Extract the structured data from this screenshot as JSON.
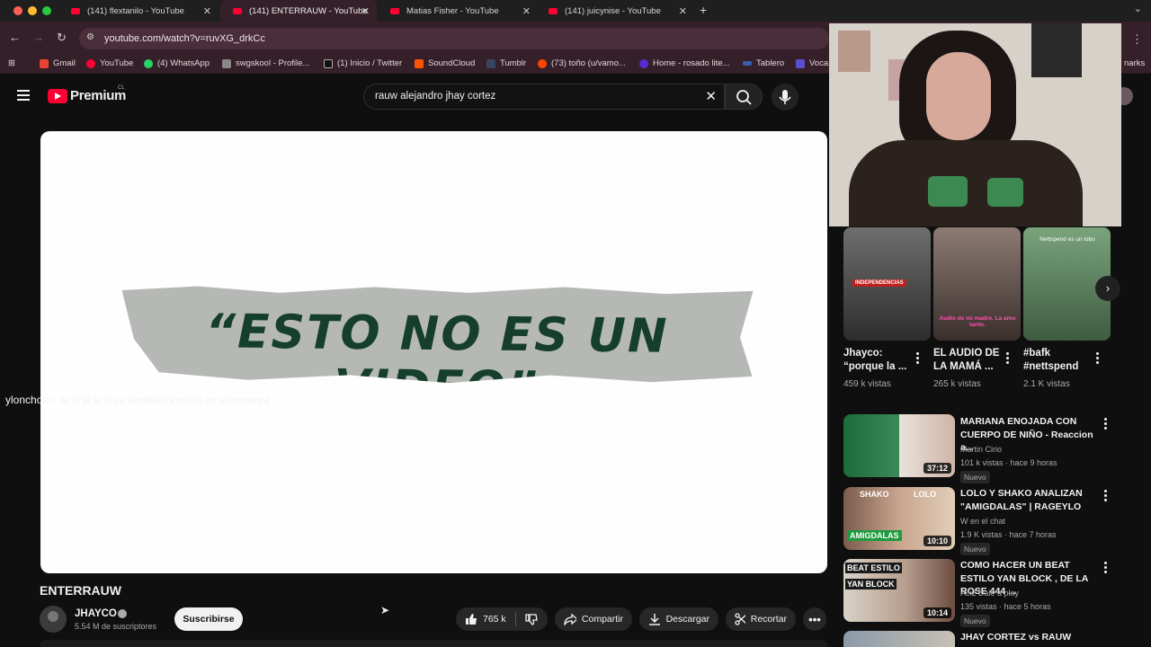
{
  "browser": {
    "tabs": [
      {
        "label": "(141) flextanilo - YouTube"
      },
      {
        "label": "(141) ENTERRAUW - YouTube"
      },
      {
        "label": "Matias Fisher - YouTube"
      },
      {
        "label": "(141) juicynise - YouTube"
      }
    ],
    "url": "youtube.com/watch?v=ruvXG_drkCc",
    "bookmarks": [
      {
        "label": "Gmail"
      },
      {
        "label": "YouTube"
      },
      {
        "label": "(4) WhatsApp"
      },
      {
        "label": "swgskool - Profile..."
      },
      {
        "label": "(1) Inicio / Twitter"
      },
      {
        "label": "SoundCloud"
      },
      {
        "label": "Tumblr"
      },
      {
        "label": "(73) toño (u/vamo..."
      },
      {
        "label": "Home - rosado lite..."
      },
      {
        "label": "Tablero"
      },
      {
        "label": "Voca"
      }
    ],
    "bookmarks_end": "narks"
  },
  "youtube": {
    "logo": "Premium",
    "country": "CL",
    "search_query": "rauw alejandro jhay cortez",
    "video": {
      "frame_text": "“ESTO NO ES UN VIDEO”",
      "overlay_text": "yloncholo : si si si si si ya también escribí en vinemerea",
      "title": "ENTERRAUW",
      "channel": "JHAYCO",
      "subscribers": "5.54 M de suscriptores",
      "subscribe": "Suscribirse",
      "likes": "765 k",
      "share": "Compartir",
      "download": "Descargar",
      "clip": "Recortar"
    },
    "shorts": [
      {
        "title": "Jhayco: “porque la ...",
        "views": "459 k vistas",
        "thumb_text": "INDEPENDENCIAS"
      },
      {
        "title": "EL AUDIO DE LA MAMÁ ...",
        "views": "265 k vistas",
        "thumb_text": "Audio de mi madre. La amo tanto."
      },
      {
        "title": "#bafk #nettspend",
        "views": "2.1 K vistas",
        "thumb_text": "Nettspend es un lobo"
      }
    ],
    "recommended": [
      {
        "title": "MARIANA ENOJADA CON CUERPO DE NIÑO - Reaccion a...",
        "channel": "Martin Cirio",
        "meta": "101 k vistas · hace 9 horas",
        "badge": "Nuevo",
        "duration": "37:12"
      },
      {
        "title": "LOLO Y SHAKO ANALIZAN \"AMIGDALAS\" | RAGEYLO",
        "channel": "W en el chat",
        "meta": "1.9 K vistas · hace 7 horas",
        "badge": "Nuevo",
        "duration": "10:10",
        "thumb_labels": [
          "SHAKO",
          "LOLO",
          "AMIGDALAS"
        ]
      },
      {
        "title": "COMO HACER UN BEAT ESTILO YAN BLOCK , DE LA ROSE 444 ...",
        "channel": "Aci2 Dale a play",
        "meta": "135 vistas · hace 5 horas",
        "badge": "Nuevo",
        "duration": "10:14",
        "thumb_labels": [
          "BEAT ESTILO",
          "YAN BLOCK"
        ]
      },
      {
        "title": "JHAY CORTEZ vs RAUW"
      }
    ]
  },
  "colors": {
    "brand_red": "#ff0033",
    "page_bg": "#0f0f0f",
    "browser_accent": "#35202a"
  }
}
